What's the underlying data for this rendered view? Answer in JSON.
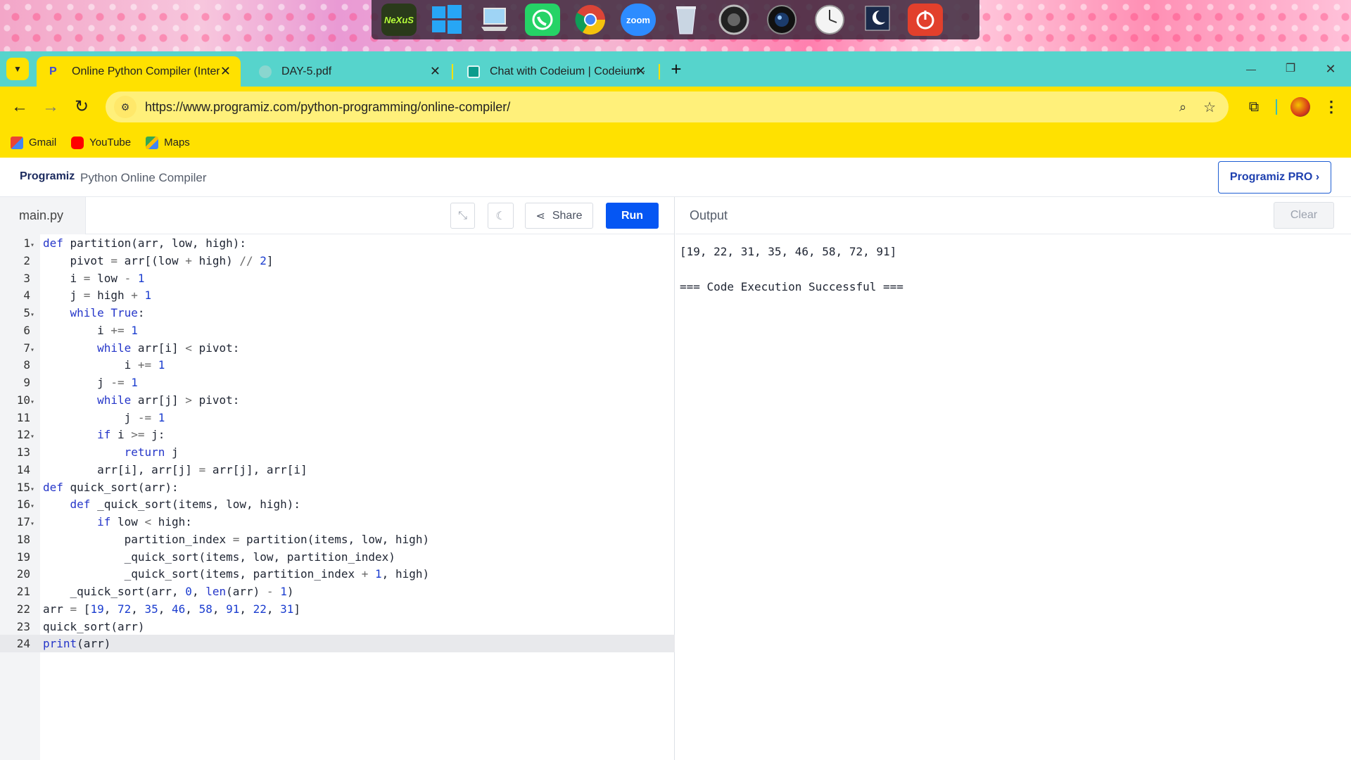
{
  "desktop": {
    "dock_icons": [
      "nexus-icon",
      "windows-icon",
      "computer-icon",
      "whatsapp-icon",
      "chrome-icon",
      "zoom-icon",
      "recycle-bin-icon",
      "audio-icon",
      "camera-icon",
      "clock-icon",
      "moon-icon",
      "power-icon"
    ],
    "nexus_label": "NeXuS",
    "zoom_label": "zoom"
  },
  "browser": {
    "tabs": [
      {
        "label": "Online Python Compiler (Interp",
        "active": true
      },
      {
        "label": "DAY-5.pdf",
        "active": false
      },
      {
        "label": "Chat with Codeium | Codeium ·",
        "active": false
      }
    ],
    "new_tab": "+",
    "window_controls": {
      "minimize": "—",
      "restore": "❐",
      "close": "✕"
    },
    "url": "https://www.programiz.com/python-programming/online-compiler/",
    "bookmarks": [
      {
        "label": "Gmail",
        "color": "#ea4335"
      },
      {
        "label": "YouTube",
        "color": "#ff0000"
      },
      {
        "label": "Maps",
        "color": "#34a853"
      }
    ]
  },
  "site": {
    "logo": "Programiz",
    "title": "Python Online Compiler",
    "pro_button": "Programiz PRO ›"
  },
  "editor": {
    "filename": "main.py",
    "share_label": "Share",
    "run_label": "Run",
    "lines": [
      {
        "n": "1",
        "fold": true,
        "html": "<span class=\"kw\">def</span> partition(arr, low, high):"
      },
      {
        "n": "2",
        "fold": false,
        "html": "    pivot <span class=\"op\">=</span> arr[(low <span class=\"op\">+</span> high) <span class=\"op\">//</span> <span class=\"num\">2</span>]"
      },
      {
        "n": "3",
        "fold": false,
        "html": "    i <span class=\"op\">=</span> low <span class=\"op\">-</span> <span class=\"num\">1</span>"
      },
      {
        "n": "4",
        "fold": false,
        "html": "    j <span class=\"op\">=</span> high <span class=\"op\">+</span> <span class=\"num\">1</span>"
      },
      {
        "n": "5",
        "fold": true,
        "html": "    <span class=\"kw\">while</span> <span class=\"kw\">True</span>:"
      },
      {
        "n": "6",
        "fold": false,
        "html": "        i <span class=\"op\">+=</span> <span class=\"num\">1</span>"
      },
      {
        "n": "7",
        "fold": true,
        "html": "        <span class=\"kw\">while</span> arr[i] <span class=\"op\">&lt;</span> pivot:"
      },
      {
        "n": "8",
        "fold": false,
        "html": "            i <span class=\"op\">+=</span> <span class=\"num\">1</span>"
      },
      {
        "n": "9",
        "fold": false,
        "html": "        j <span class=\"op\">-=</span> <span class=\"num\">1</span>"
      },
      {
        "n": "10",
        "fold": true,
        "html": "        <span class=\"kw\">while</span> arr[j] <span class=\"op\">&gt;</span> pivot:"
      },
      {
        "n": "11",
        "fold": false,
        "html": "            j <span class=\"op\">-=</span> <span class=\"num\">1</span>"
      },
      {
        "n": "12",
        "fold": true,
        "html": "        <span class=\"kw\">if</span> i <span class=\"op\">&gt;=</span> j:"
      },
      {
        "n": "13",
        "fold": false,
        "html": "            <span class=\"kw\">return</span> j"
      },
      {
        "n": "14",
        "fold": false,
        "html": "        arr[i], arr[j] <span class=\"op\">=</span> arr[j], arr[i]"
      },
      {
        "n": "15",
        "fold": true,
        "html": "<span class=\"kw\">def</span> quick_sort(arr):"
      },
      {
        "n": "16",
        "fold": true,
        "html": "    <span class=\"kw\">def</span> _quick_sort(items, low, high):"
      },
      {
        "n": "17",
        "fold": true,
        "html": "        <span class=\"kw\">if</span> low <span class=\"op\">&lt;</span> high:"
      },
      {
        "n": "18",
        "fold": false,
        "html": "            partition_index <span class=\"op\">=</span> partition(items, low, high)"
      },
      {
        "n": "19",
        "fold": false,
        "html": "            _quick_sort(items, low, partition_index)"
      },
      {
        "n": "20",
        "fold": false,
        "html": "            _quick_sort(items, partition_index <span class=\"op\">+</span> <span class=\"num\">1</span>, high)"
      },
      {
        "n": "21",
        "fold": false,
        "html": "    _quick_sort(arr, <span class=\"num\">0</span>, <span class=\"kw\">len</span>(arr) <span class=\"op\">-</span> <span class=\"num\">1</span>)"
      },
      {
        "n": "22",
        "fold": false,
        "html": "arr <span class=\"op\">=</span> [<span class=\"num\">19</span>, <span class=\"num\">72</span>, <span class=\"num\">35</span>, <span class=\"num\">46</span>, <span class=\"num\">58</span>, <span class=\"num\">91</span>, <span class=\"num\">22</span>, <span class=\"num\">31</span>]"
      },
      {
        "n": "23",
        "fold": false,
        "html": "quick_sort(arr)"
      },
      {
        "n": "24",
        "fold": false,
        "html": "<span class=\"kw\">print</span>(arr)"
      }
    ]
  },
  "output": {
    "title": "Output",
    "clear_label": "Clear",
    "lines": [
      "[19, 22, 31, 35, 46, 58, 72, 91]",
      "",
      "=== Code Execution Successful ==="
    ]
  },
  "colors": {
    "tab_bar": "#56d4cc",
    "address_bar": "#ffe100",
    "run_button": "#0556f3",
    "pro_border": "#1e5ed3"
  }
}
